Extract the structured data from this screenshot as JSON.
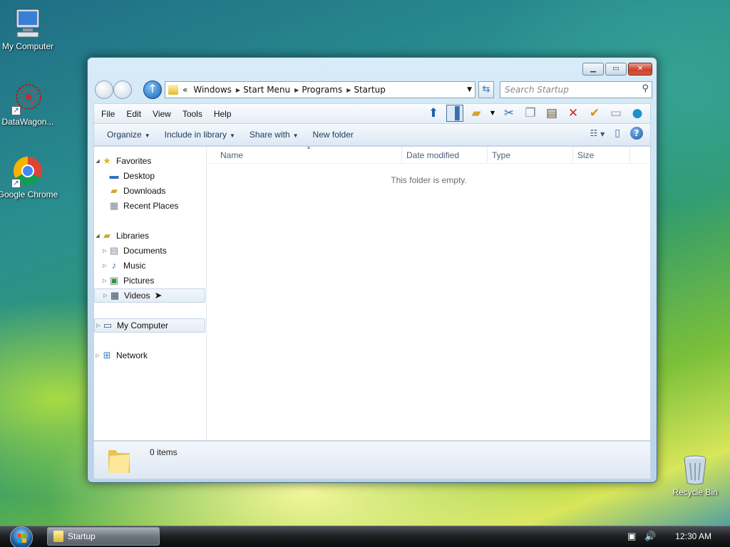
{
  "desktop": {
    "icons": [
      {
        "label": "My Computer"
      },
      {
        "label": "DataWagon..."
      },
      {
        "label": "Google Chrome"
      },
      {
        "label": "Recycle Bin"
      }
    ]
  },
  "window": {
    "address": {
      "overflow": "«",
      "crumbs": [
        "Windows",
        "Start Menu",
        "Programs",
        "Startup"
      ]
    },
    "search_placeholder": "Search Startup",
    "menu": [
      "File",
      "Edit",
      "View",
      "Tools",
      "Help"
    ],
    "commands": [
      "Organize",
      "Include in library",
      "Share with",
      "New folder"
    ],
    "nav": {
      "favorites": {
        "label": "Favorites",
        "items": [
          "Desktop",
          "Downloads",
          "Recent Places"
        ]
      },
      "libraries": {
        "label": "Libraries",
        "items": [
          "Documents",
          "Music",
          "Pictures",
          "Videos"
        ]
      },
      "computer": "My Computer",
      "network": "Network"
    },
    "columns": [
      "Name",
      "Date modified",
      "Type",
      "Size"
    ],
    "empty_message": "This folder is empty.",
    "details": {
      "count": "0 items"
    }
  },
  "taskbar": {
    "active_window": "Startup",
    "clock": "12:30 AM"
  }
}
